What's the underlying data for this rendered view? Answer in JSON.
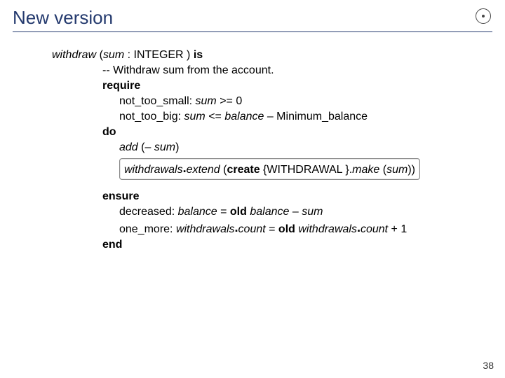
{
  "title": "New version",
  "page_number": "38",
  "code": {
    "l1_withdraw": "withdraw",
    "l1_paren_open": " (",
    "l1_sum": "sum",
    "l1_type": " : INTEGER )",
    "l1_is": " is",
    "l2_comment": "-- Withdraw sum from the account.",
    "l3_require": "require",
    "l4_tag": "not_too_small: ",
    "l4_sum": "sum",
    "l4_rest": " >= 0",
    "l5_tag": "not_too_big: ",
    "l5_sum": "sum",
    "l5_mid": " <= ",
    "l5_balance": "balance",
    "l5_rest": " – Minimum_balance",
    "l6_do": "do",
    "l7_add": "add",
    "l7_args": " (– ",
    "l7_sum": "sum",
    "l7_close": ")",
    "l8_withdrawals": "withdrawals",
    "l8_extend": "extend",
    "l8_open": " (",
    "l8_create": "create",
    "l8_mid": " {WITHDRAWAL }.",
    "l8_make": "make",
    "l8_open2": " (",
    "l8_sum": "sum",
    "l8_close": "))",
    "l9_ensure": "ensure",
    "l10_tag": "decreased: ",
    "l10_balance": "balance",
    "l10_eq": " = ",
    "l10_old": "old",
    "l10_bal2": " balance",
    "l10_rest": " – ",
    "l10_sum": "sum",
    "l11_tag": "one_more: ",
    "l11_w1": "withdrawals",
    "l11_count1": "count",
    "l11_eq": " = ",
    "l11_old": "old",
    "l11_w2": " withdrawals",
    "l11_count2": "count",
    "l11_plus": " + 1",
    "l12_end": "end"
  }
}
